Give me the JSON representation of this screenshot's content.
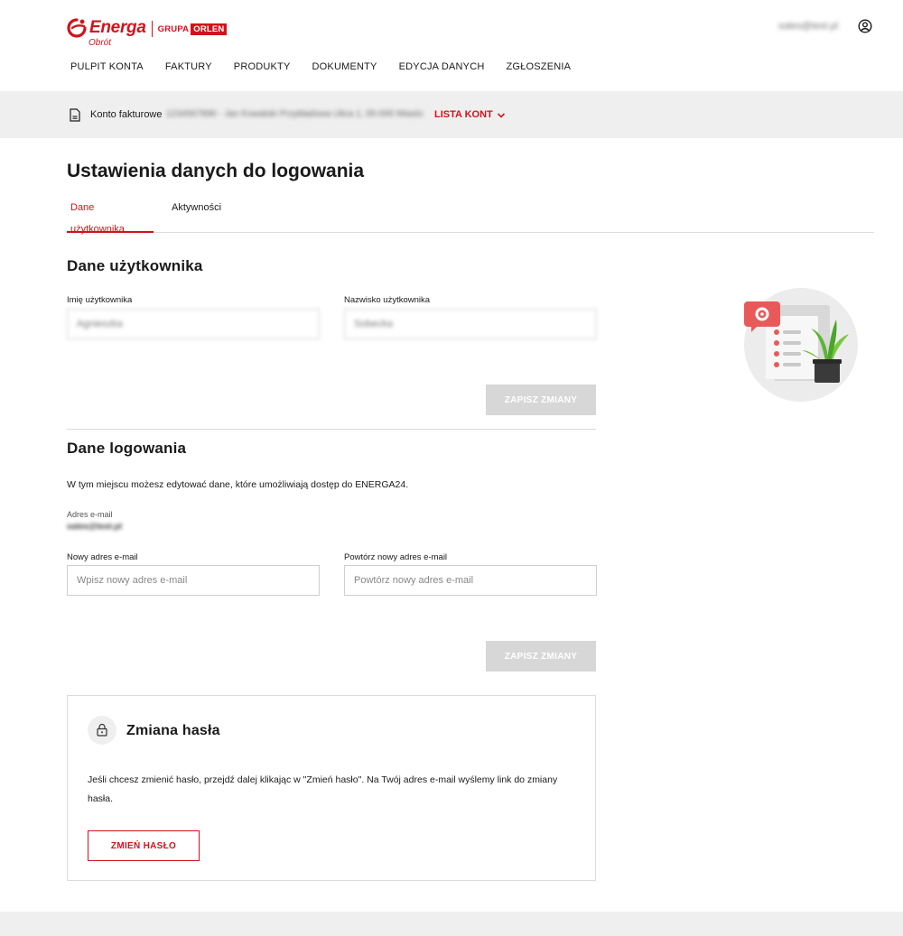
{
  "brand": {
    "name": "Energa",
    "sub": "Obrót",
    "group_prefix": "GRUPA",
    "group_name": "ORLEN",
    "accent": "#d3121b"
  },
  "user": {
    "email": "sales@test.pl",
    "icon": "user-circle-icon"
  },
  "nav": [
    {
      "label": "PULPIT KONTA"
    },
    {
      "label": "FAKTURY"
    },
    {
      "label": "PRODUKTY"
    },
    {
      "label": "DOKUMENTY"
    },
    {
      "label": "EDYCJA DANYCH"
    },
    {
      "label": "ZGŁOSZENIA"
    }
  ],
  "account_bar": {
    "label": "Konto fakturowe",
    "number": "1234567890 - Jan Kowalski Przykładowa Ulica 1, 00-000 Miasto",
    "list_label": "LISTA KONT",
    "icon": "document-icon"
  },
  "page": {
    "title": "Ustawienia danych do logowania"
  },
  "tabs": [
    {
      "label": "Dane użytkownika",
      "active": true
    },
    {
      "label": "Aktywności",
      "active": false
    }
  ],
  "user_data": {
    "title": "Dane użytkownika",
    "first_name_label": "Imię użytkownika",
    "first_name_value": "Agnieszka",
    "last_name_label": "Nazwisko użytkownika",
    "last_name_value": "Sobecka",
    "save_label": "ZAPISZ ZMIANY"
  },
  "login_data": {
    "title": "Dane logowania",
    "description": "W tym miejscu możesz edytować dane, które umożliwiają dostęp do ENERGA24.",
    "email_label": "Adres e-mail",
    "email_value": "sales@test.pl",
    "new_email_label": "Nowy adres e-mail",
    "new_email_placeholder": "Wpisz nowy adres e-mail",
    "repeat_email_label": "Powtórz nowy adres e-mail",
    "repeat_email_placeholder": "Powtórz nowy adres e-mail",
    "save_label": "ZAPISZ ZMIANY"
  },
  "password": {
    "title": "Zmiana hasła",
    "text": "Jeśli chcesz zmienić hasło, przejdź dalej klikając w \"Zmień hasło\". Na Twój adres e-mail wyślemy link do zmiany hasła.",
    "button_label": "ZMIEŃ HASŁO",
    "icon": "lock-icon"
  },
  "colors": {
    "accent": "#d3121b",
    "disabled_button": "#d7d7d7",
    "bar_background": "#efefef",
    "border": "#dcdcdc"
  }
}
